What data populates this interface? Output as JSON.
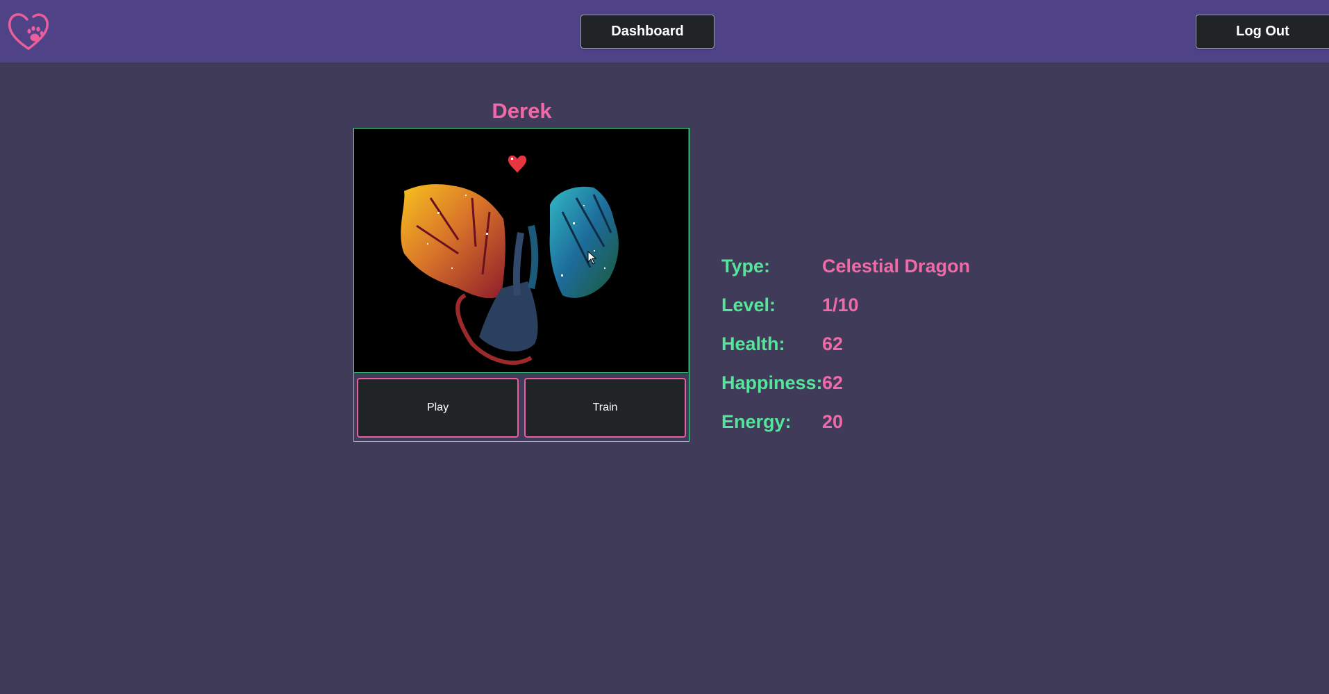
{
  "header": {
    "logo_icon": "heart-paw-icon",
    "dashboard_label": "Dashboard",
    "logout_label": "Log Out"
  },
  "pet": {
    "name": "Derek",
    "image_alt_icon": "celestial-dragon-pixel-art",
    "status_icon": "heart-icon",
    "actions": {
      "play_label": "Play",
      "train_label": "Train"
    },
    "stats": [
      {
        "label": "Type:",
        "value": "Celestial Dragon"
      },
      {
        "label": "Level:",
        "value": "1/10"
      },
      {
        "label": "Health:",
        "value": "62"
      },
      {
        "label": "Happiness:",
        "value": "62"
      },
      {
        "label": "Energy:",
        "value": "20"
      }
    ]
  },
  "colors": {
    "navbar": "#4f4286",
    "background": "#403b58",
    "accent_pink": "#f06aa9",
    "accent_green": "#55e59a",
    "button_dark": "#202427"
  }
}
